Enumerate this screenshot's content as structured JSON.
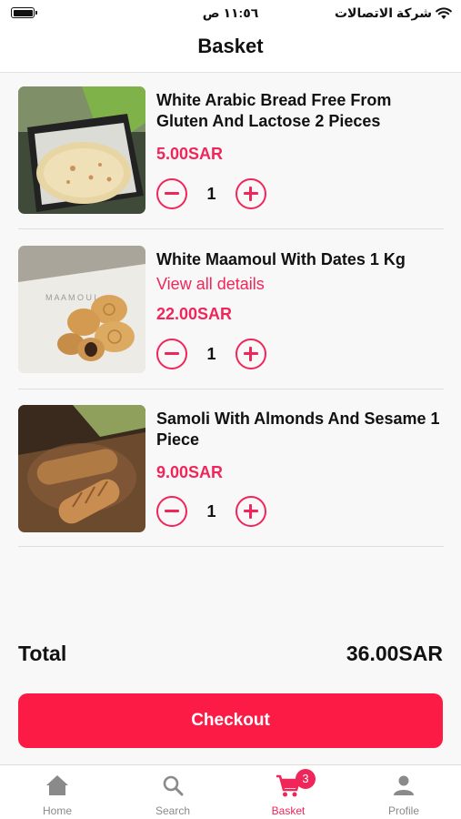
{
  "status_bar": {
    "time": "١١:٥٦ ص",
    "carrier": "شركة الاتصالات"
  },
  "header": {
    "title": "Basket"
  },
  "items": [
    {
      "name": "White Arabic Bread Free From Gluten And Lactose 2 Pieces",
      "price": "5.00SAR",
      "quantity": "1",
      "image": "arabic-bread"
    },
    {
      "name": "White Maamoul With Dates 1 Kg",
      "link": "View all details",
      "price": "22.00SAR",
      "quantity": "1",
      "image": "maamoul"
    },
    {
      "name": "Samoli With Almonds And Sesame 1 Piece",
      "price": "9.00SAR",
      "quantity": "1",
      "image": "samoli-bread"
    }
  ],
  "summary": {
    "total_label": "Total",
    "total_value": "36.00SAR"
  },
  "checkout": {
    "label": "Checkout"
  },
  "tab_bar": {
    "tabs": [
      {
        "label": "Home",
        "icon": "home-icon"
      },
      {
        "label": "Search",
        "icon": "search-icon"
      },
      {
        "label": "Basket",
        "icon": "cart-icon",
        "badge": "3",
        "active": true
      },
      {
        "label": "Profile",
        "icon": "person-icon"
      }
    ]
  },
  "colors": {
    "accent": "#f0255a",
    "checkout": "#fc1b44",
    "inactive_tab": "#8a8a8a"
  }
}
